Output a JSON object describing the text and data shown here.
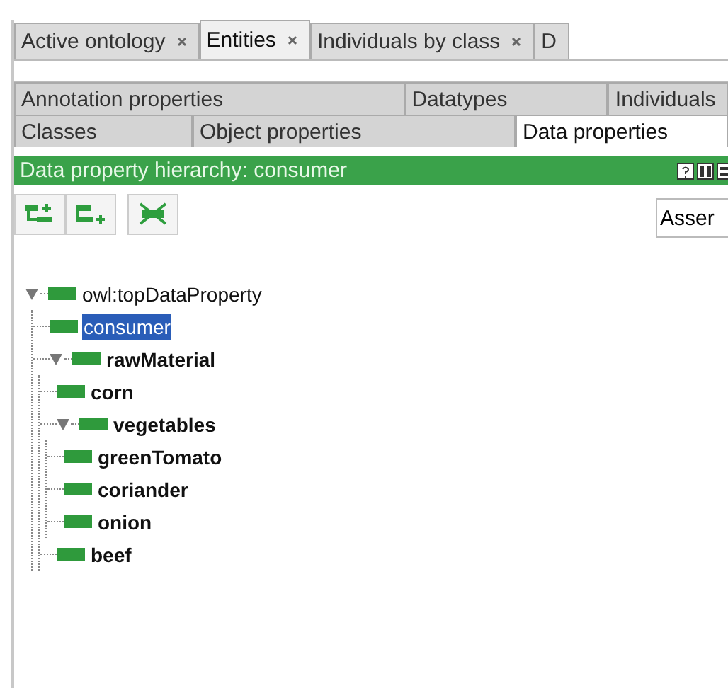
{
  "main_tabs": [
    {
      "label": "Active ontology",
      "closable": true,
      "selected": false
    },
    {
      "label": "Entities",
      "closable": true,
      "selected": true
    },
    {
      "label": "Individuals by class",
      "closable": true,
      "selected": false
    },
    {
      "label": "D",
      "closable": false,
      "selected": false
    }
  ],
  "entity_tabs": [
    [
      {
        "label": "Annotation properties",
        "selected": false
      },
      {
        "label": "Datatypes",
        "selected": false
      },
      {
        "label": "Individuals",
        "selected": false
      }
    ],
    [
      {
        "label": "Classes",
        "selected": false
      },
      {
        "label": "Object properties",
        "selected": false
      },
      {
        "label": "Data properties",
        "selected": true
      }
    ]
  ],
  "view": {
    "title": "Data property hierarchy: consumer",
    "mode_dropdown": "Asser"
  },
  "tree": [
    {
      "label": "owl:topDataProperty",
      "bold": false,
      "selected": false,
      "expanded": true,
      "children": [
        {
          "label": "consumer",
          "bold": false,
          "selected": true
        },
        {
          "label": "rawMaterial",
          "bold": true,
          "selected": false,
          "expanded": true,
          "children": [
            {
              "label": "corn",
              "bold": true,
              "selected": false
            },
            {
              "label": "vegetables",
              "bold": true,
              "selected": false,
              "expanded": true,
              "children": [
                {
                  "label": "greenTomato",
                  "bold": true,
                  "selected": false
                },
                {
                  "label": "coriander",
                  "bold": true,
                  "selected": false
                },
                {
                  "label": "onion",
                  "bold": true,
                  "selected": false
                }
              ]
            },
            {
              "label": "beef",
              "bold": true,
              "selected": false
            }
          ]
        }
      ]
    }
  ]
}
